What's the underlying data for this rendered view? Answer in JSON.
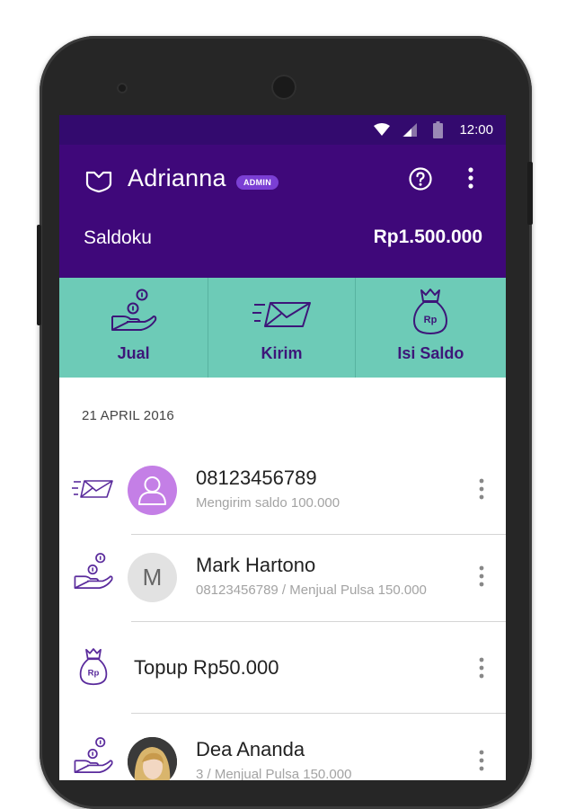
{
  "status_bar": {
    "time": "12:00"
  },
  "header": {
    "user_name": "Adrianna",
    "role_badge": "ADMIN"
  },
  "balance": {
    "label": "Saldoku",
    "value": "Rp1.500.000"
  },
  "actions": [
    {
      "label": "Jual",
      "icon": "hand-coins-icon"
    },
    {
      "label": "Kirim",
      "icon": "envelope-send-icon"
    },
    {
      "label": "Isi Saldo",
      "icon": "money-bag-icon"
    }
  ],
  "history": {
    "date": "21 APRIL 2016",
    "items": [
      {
        "title": "08123456789",
        "subtitle": "Mengirim saldo 100.000",
        "type_icon": "envelope-send-icon",
        "avatar": "person-avatar"
      },
      {
        "title": "Mark Hartono",
        "subtitle": "08123456789 / Menjual Pulsa 150.000",
        "type_icon": "hand-coins-icon",
        "avatar_initial": "M"
      },
      {
        "title": "Topup Rp50.000",
        "type_icon": "money-bag-icon"
      },
      {
        "title": "Dea Ananda",
        "subtitle": "3 / Menjual Pulsa 150.000",
        "type_icon": "hand-coins-icon",
        "avatar": "photo-avatar"
      }
    ]
  },
  "colors": {
    "primary": "#3f087a",
    "status_bar": "#330a6e",
    "accent": "#6dcbb7",
    "avatar_purple": "#c47fe6"
  }
}
